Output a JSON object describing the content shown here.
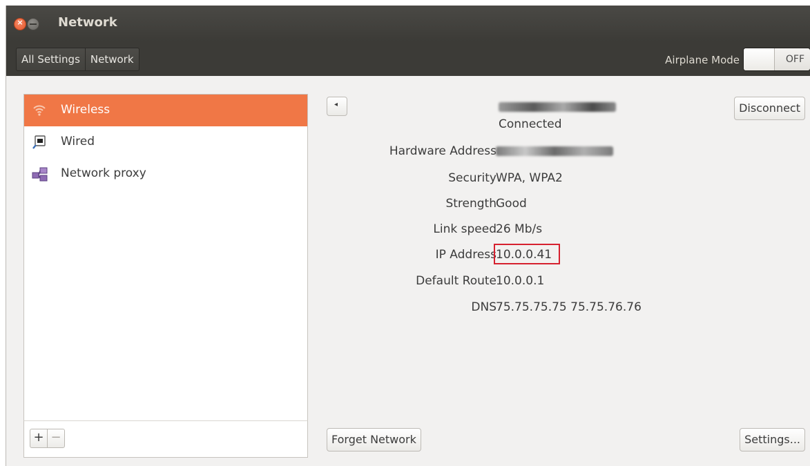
{
  "window": {
    "title": "Network"
  },
  "toolbar": {
    "breadcrumbs": [
      "All Settings",
      "Network"
    ],
    "airplane_mode_label": "Airplane Mode",
    "airplane_mode_state": "OFF"
  },
  "sidebar": {
    "items": [
      {
        "label": "Wireless",
        "icon": "wireless-icon",
        "selected": true
      },
      {
        "label": "Wired",
        "icon": "wired-icon",
        "selected": false
      },
      {
        "label": "Network proxy",
        "icon": "network-proxy-icon",
        "selected": false
      }
    ],
    "add_label": "+",
    "remove_label": "−"
  },
  "details": {
    "status": "Connected",
    "rows": [
      {
        "label": "Hardware Address",
        "value": ""
      },
      {
        "label": "Security",
        "value": "WPA, WPA2"
      },
      {
        "label": "Strength",
        "value": "Good"
      },
      {
        "label": "Link speed",
        "value": "26 Mb/s"
      },
      {
        "label": "IP Address",
        "value": "10.0.0.41"
      },
      {
        "label": "Default Route",
        "value": "10.0.0.1"
      },
      {
        "label": "DNS",
        "value": "75.75.75.75 75.75.76.76"
      }
    ]
  },
  "buttons": {
    "disconnect": "Disconnect",
    "forget": "Forget Network",
    "settings": "Settings..."
  },
  "colors": {
    "accent": "#f07746",
    "highlight_box": "#d6202e",
    "titlebar": "#3c3b37"
  }
}
